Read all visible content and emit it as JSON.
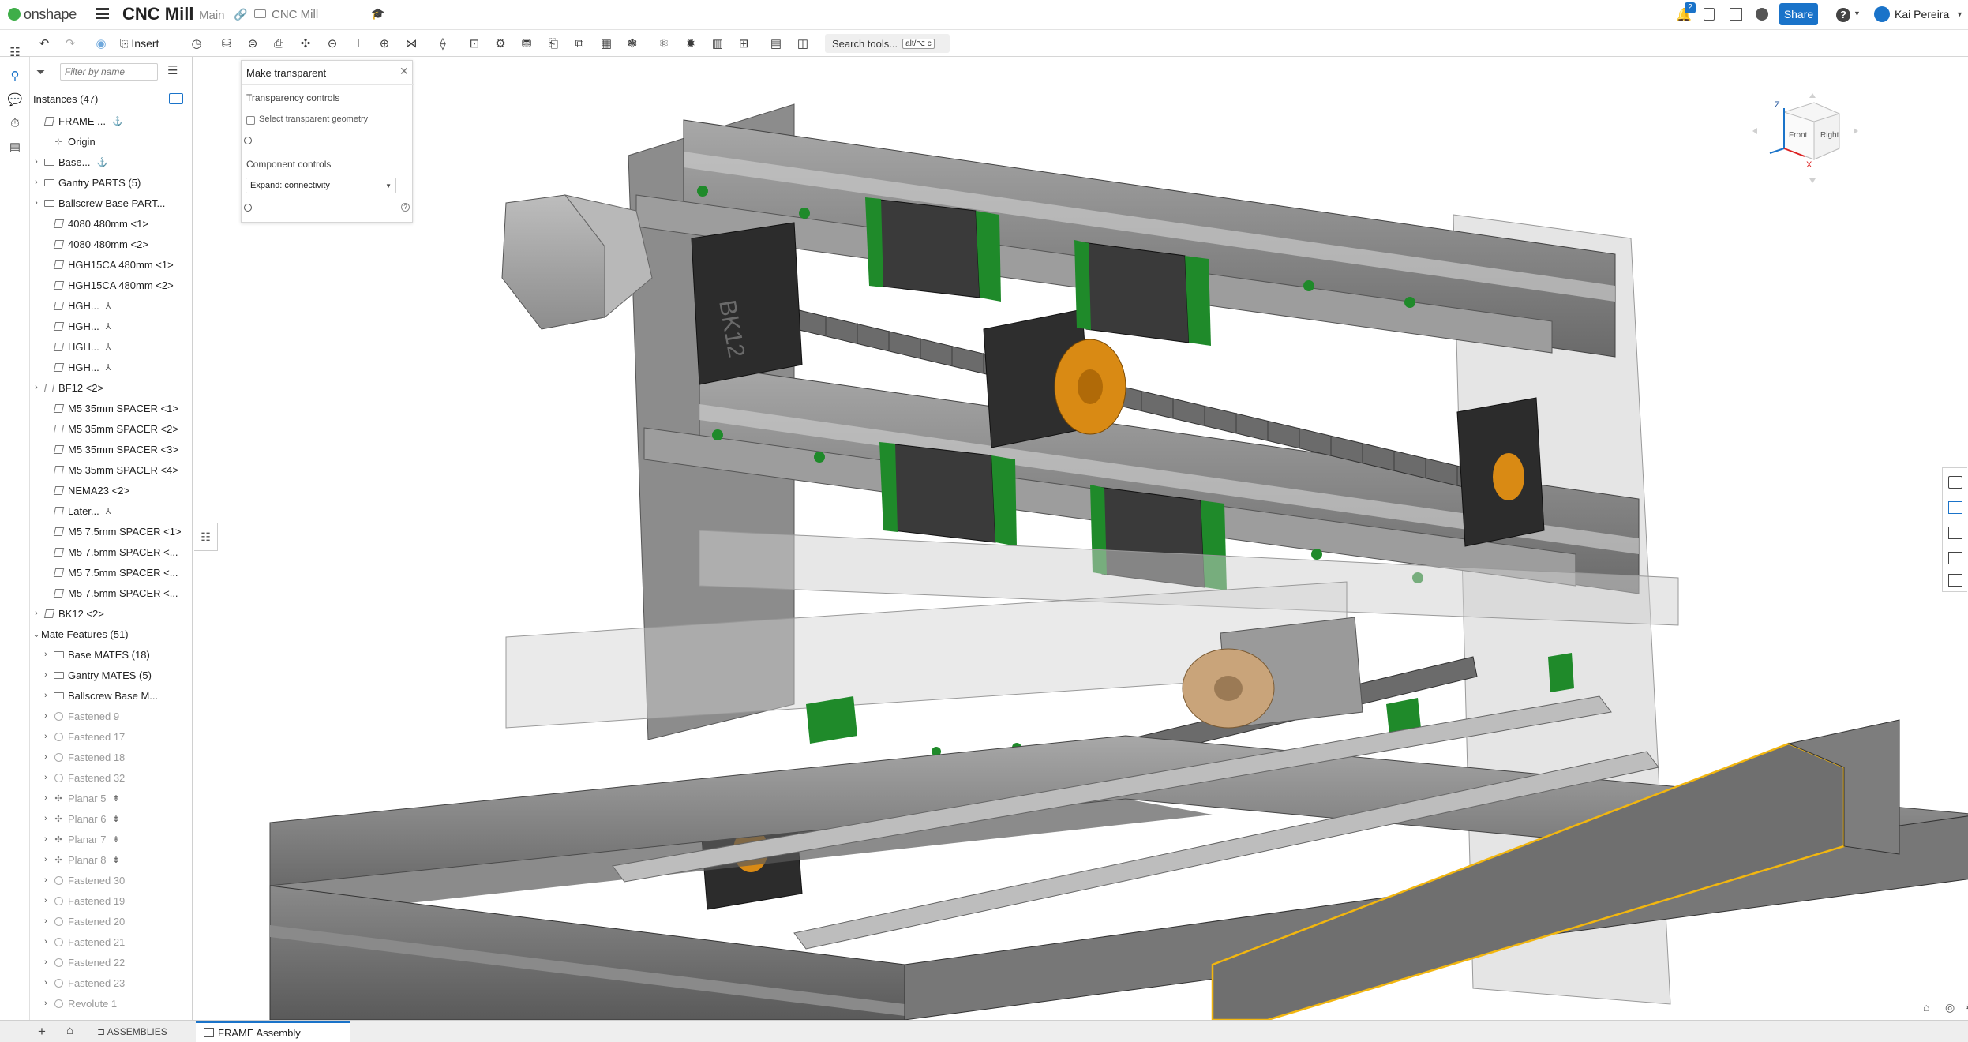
{
  "app": {
    "logo_text": "onshape",
    "doc_title": "CNC Mill",
    "branch": "Main",
    "folder": "CNC Mill"
  },
  "header_right": {
    "notif_count": "2",
    "share_label": "Share",
    "help_label": "?",
    "user_name": "Kai Pereira"
  },
  "toolbar": {
    "insert_label": "Insert",
    "search_label": "Search tools...",
    "search_shortcut": "alt/⌥ c"
  },
  "tree": {
    "filter_placeholder": "Filter by name",
    "instances_label": "Instances (47)",
    "items": [
      {
        "label": "FRAME ...",
        "kind": "part",
        "caret": "",
        "dim": false,
        "indent": 0,
        "extra": "⚓"
      },
      {
        "label": "Origin",
        "kind": "origin",
        "caret": "",
        "dim": false,
        "indent": 1,
        "extra": ""
      },
      {
        "label": "Base...",
        "kind": "folder",
        "caret": "›",
        "dim": false,
        "indent": 0,
        "extra": "⚓"
      },
      {
        "label": "Gantry PARTS (5)",
        "kind": "folder",
        "caret": "›",
        "dim": false,
        "indent": 0,
        "extra": ""
      },
      {
        "label": "Ballscrew Base PART...",
        "kind": "folder",
        "caret": "›",
        "dim": false,
        "indent": 0,
        "extra": ""
      },
      {
        "label": "4080 480mm <1>",
        "kind": "part",
        "caret": "",
        "dim": false,
        "indent": 1,
        "extra": ""
      },
      {
        "label": "4080 480mm <2>",
        "kind": "part",
        "caret": "",
        "dim": false,
        "indent": 1,
        "extra": ""
      },
      {
        "label": "HGH15CA 480mm <1>",
        "kind": "part",
        "caret": "",
        "dim": false,
        "indent": 1,
        "extra": ""
      },
      {
        "label": "HGH15CA 480mm <2>",
        "kind": "part",
        "caret": "",
        "dim": false,
        "indent": 1,
        "extra": ""
      },
      {
        "label": "HGH...",
        "kind": "part",
        "caret": "",
        "dim": false,
        "indent": 1,
        "extra": "⅄"
      },
      {
        "label": "HGH...",
        "kind": "part",
        "caret": "",
        "dim": false,
        "indent": 1,
        "extra": "⅄"
      },
      {
        "label": "HGH...",
        "kind": "part",
        "caret": "",
        "dim": false,
        "indent": 1,
        "extra": "⅄"
      },
      {
        "label": "HGH...",
        "kind": "part",
        "caret": "",
        "dim": false,
        "indent": 1,
        "extra": "⅄"
      },
      {
        "label": "BF12 <2>",
        "kind": "sub",
        "caret": "›",
        "dim": false,
        "indent": 0,
        "extra": ""
      },
      {
        "label": "M5 35mm SPACER <1>",
        "kind": "part",
        "caret": "",
        "dim": false,
        "indent": 1,
        "extra": ""
      },
      {
        "label": "M5 35mm SPACER <2>",
        "kind": "part",
        "caret": "",
        "dim": false,
        "indent": 1,
        "extra": ""
      },
      {
        "label": "M5 35mm SPACER <3>",
        "kind": "part",
        "caret": "",
        "dim": false,
        "indent": 1,
        "extra": ""
      },
      {
        "label": "M5 35mm SPACER <4>",
        "kind": "part",
        "caret": "",
        "dim": false,
        "indent": 1,
        "extra": ""
      },
      {
        "label": "NEMA23 <2>",
        "kind": "part",
        "caret": "",
        "dim": false,
        "indent": 1,
        "extra": ""
      },
      {
        "label": "Later...",
        "kind": "part",
        "caret": "",
        "dim": false,
        "indent": 1,
        "extra": "⅄"
      },
      {
        "label": "M5 7.5mm SPACER <1>",
        "kind": "part",
        "caret": "",
        "dim": false,
        "indent": 1,
        "extra": ""
      },
      {
        "label": "M5 7.5mm SPACER <...",
        "kind": "part",
        "caret": "",
        "dim": false,
        "indent": 1,
        "extra": ""
      },
      {
        "label": "M5 7.5mm SPACER <...",
        "kind": "part",
        "caret": "",
        "dim": false,
        "indent": 1,
        "extra": ""
      },
      {
        "label": "M5 7.5mm SPACER <...",
        "kind": "part",
        "caret": "",
        "dim": false,
        "indent": 1,
        "extra": ""
      },
      {
        "label": "BK12 <2>",
        "kind": "sub",
        "caret": "›",
        "dim": false,
        "indent": 0,
        "extra": ""
      },
      {
        "label": "Mate Features (51)",
        "kind": "none",
        "caret": "⌄",
        "dim": false,
        "indent": 0,
        "extra": ""
      },
      {
        "label": "Base MATES (18)",
        "kind": "folder",
        "caret": "›",
        "dim": false,
        "indent": 1,
        "extra": ""
      },
      {
        "label": "Gantry MATES (5)",
        "kind": "folder",
        "caret": "›",
        "dim": false,
        "indent": 1,
        "extra": ""
      },
      {
        "label": "Ballscrew Base M...",
        "kind": "folder",
        "caret": "›",
        "dim": false,
        "indent": 1,
        "extra": ""
      },
      {
        "label": "Fastened 9",
        "kind": "mate",
        "caret": "›",
        "dim": true,
        "indent": 1,
        "extra": ""
      },
      {
        "label": "Fastened 17",
        "kind": "mate",
        "caret": "›",
        "dim": true,
        "indent": 1,
        "extra": ""
      },
      {
        "label": "Fastened 18",
        "kind": "mate",
        "caret": "›",
        "dim": true,
        "indent": 1,
        "extra": ""
      },
      {
        "label": "Fastened 32",
        "kind": "mate",
        "caret": "›",
        "dim": true,
        "indent": 1,
        "extra": ""
      },
      {
        "label": "Planar 5",
        "kind": "planar",
        "caret": "›",
        "dim": true,
        "indent": 1,
        "extra": "⇟"
      },
      {
        "label": "Planar 6",
        "kind": "planar",
        "caret": "›",
        "dim": true,
        "indent": 1,
        "extra": "⇟"
      },
      {
        "label": "Planar 7",
        "kind": "planar",
        "caret": "›",
        "dim": true,
        "indent": 1,
        "extra": "⇟"
      },
      {
        "label": "Planar 8",
        "kind": "planar",
        "caret": "›",
        "dim": true,
        "indent": 1,
        "extra": "⇟"
      },
      {
        "label": "Fastened 30",
        "kind": "mate",
        "caret": "›",
        "dim": true,
        "indent": 1,
        "extra": ""
      },
      {
        "label": "Fastened 19",
        "kind": "mate",
        "caret": "›",
        "dim": true,
        "indent": 1,
        "extra": ""
      },
      {
        "label": "Fastened 20",
        "kind": "mate",
        "caret": "›",
        "dim": true,
        "indent": 1,
        "extra": ""
      },
      {
        "label": "Fastened 21",
        "kind": "mate",
        "caret": "›",
        "dim": true,
        "indent": 1,
        "extra": ""
      },
      {
        "label": "Fastened 22",
        "kind": "mate",
        "caret": "›",
        "dim": true,
        "indent": 1,
        "extra": ""
      },
      {
        "label": "Fastened 23",
        "kind": "mate",
        "caret": "›",
        "dim": true,
        "indent": 1,
        "extra": ""
      },
      {
        "label": "Revolute 1",
        "kind": "mate",
        "caret": "›",
        "dim": true,
        "indent": 1,
        "extra": ""
      }
    ]
  },
  "dialog": {
    "title": "Make transparent",
    "section1": "Transparency controls",
    "checkbox_label": "Select transparent geometry",
    "section2": "Component controls",
    "select_value": "Expand: connectivity"
  },
  "viewcube": {
    "top": "Z",
    "front": "Front",
    "right": "Right",
    "x": "X"
  },
  "parts_labels": {
    "bk12": "BK12"
  },
  "bottom": {
    "assemblies_label": "ASSEMBLIES",
    "tab_label": "FRAME Assembly"
  },
  "colors": {
    "accent": "#1a73c9",
    "green": "#1f8a2a",
    "orange": "#d98a14",
    "frame": "#6f6f6f",
    "frame_light": "#9a9a9a",
    "select": "#f2b60f"
  }
}
